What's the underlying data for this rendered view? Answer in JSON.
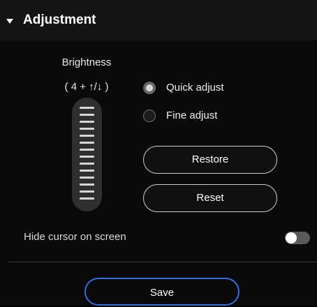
{
  "header": {
    "title": "Adjustment",
    "expanded": true,
    "icon": "caret-down-icon"
  },
  "brightness": {
    "label": "Brightness",
    "hint": "( 4 + ↑/↓ )",
    "slider_icon": "brightness-slider"
  },
  "adjust_mode": {
    "options": [
      {
        "label": "Quick adjust",
        "selected": true
      },
      {
        "label": "Fine adjust",
        "selected": false
      }
    ]
  },
  "buttons": {
    "restore_label": "Restore",
    "reset_label": "Reset",
    "save_label": "Save"
  },
  "hide_cursor": {
    "label": "Hide cursor on screen",
    "enabled": false
  },
  "colors": {
    "background": "#0a0a0a",
    "header_background": "#141414",
    "accent": "#2f6fe0",
    "button_border": "#cfcfcf"
  }
}
